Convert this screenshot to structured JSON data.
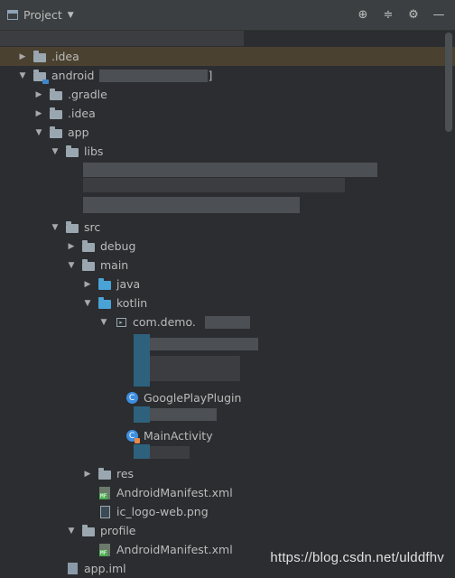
{
  "header": {
    "title": "Project",
    "tools": [
      "locate-icon",
      "collapse-icon",
      "gear-icon",
      "hide-icon"
    ]
  },
  "tree": {
    "rows": [
      {
        "label": ".idea",
        "icon": "folder",
        "arrow": "right",
        "depth": 1,
        "selected": true
      },
      {
        "label": "android",
        "icon": "module-folder",
        "arrow": "down",
        "depth": 1,
        "suffix": "]"
      },
      {
        "label": ".gradle",
        "icon": "folder",
        "arrow": "right",
        "depth": 2
      },
      {
        "label": ".idea",
        "icon": "folder",
        "arrow": "right",
        "depth": 2
      },
      {
        "label": "app",
        "icon": "folder",
        "arrow": "down",
        "depth": 2
      },
      {
        "label": "libs",
        "icon": "folder",
        "arrow": "down",
        "depth": 3
      },
      {
        "label": "src",
        "icon": "folder",
        "arrow": "down",
        "depth": 3
      },
      {
        "label": "debug",
        "icon": "folder",
        "arrow": "right",
        "depth": 4
      },
      {
        "label": "main",
        "icon": "folder",
        "arrow": "down",
        "depth": 4
      },
      {
        "label": "java",
        "icon": "blue-folder",
        "arrow": "right",
        "depth": 5
      },
      {
        "label": "kotlin",
        "icon": "blue-folder",
        "arrow": "down",
        "depth": 5
      },
      {
        "label": "com.demo.",
        "icon": "package",
        "arrow": "down",
        "depth": 6
      },
      {
        "label": "GooglePlayPlugin",
        "icon": "kotlin-class",
        "depth": 7
      },
      {
        "label": "MainActivity",
        "icon": "activity-class",
        "depth": 7
      },
      {
        "label": "res",
        "icon": "folder",
        "arrow": "right",
        "depth": 5
      },
      {
        "label": "AndroidManifest.xml",
        "icon": "manifest",
        "depth": 5
      },
      {
        "label": "ic_logo-web.png",
        "icon": "image",
        "depth": 5
      },
      {
        "label": "profile",
        "icon": "folder",
        "arrow": "down",
        "depth": 4
      },
      {
        "label": "AndroidManifest.xml",
        "icon": "manifest",
        "depth": 5
      },
      {
        "label": "app.iml",
        "icon": "iml",
        "depth": 3
      }
    ]
  },
  "watermark": "https://blog.csdn.net/ulddfhv",
  "colors": {
    "background": "#2b2d30",
    "header": "#3c3f41",
    "selection": "#4a4130",
    "text": "#bbbbbb",
    "folder": "#9aa7b0",
    "source_folder": "#4aa3d6"
  }
}
